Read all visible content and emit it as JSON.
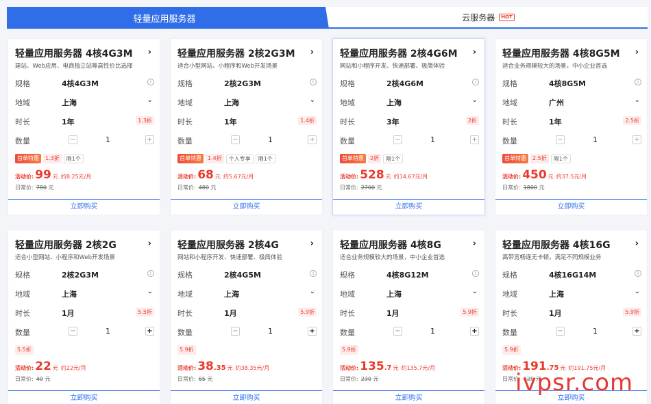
{
  "tabs": {
    "active_label": "轻量应用服务器",
    "cloud_label": "云服务器",
    "hot_badge": "HOT"
  },
  "labels": {
    "spec": "规格",
    "region": "地域",
    "duration": "时长",
    "quantity": "数量",
    "activity_price": "活动价:",
    "original_price": "日常价:",
    "buy": "立即购买",
    "first_order": "首单特惠",
    "currency": "元"
  },
  "cards": [
    {
      "title": "轻量应用服务器 4核4G3M",
      "desc": "建站、Web应用、电商独立站等高性价比选择",
      "spec": "4核4G3M",
      "region": "上海",
      "duration": "1年",
      "duration_disc": "1.3折",
      "qty": "1",
      "first_order": true,
      "disc": "1.3折",
      "extra_tags": [
        "限1个"
      ],
      "price_int": "99",
      "price_dec": "",
      "per_month": "约8.25元/月",
      "original": "780"
    },
    {
      "title": "轻量应用服务器 2核2G3M",
      "desc": "适合小型网站、小程序和Web开发场景",
      "spec": "2核2G3M",
      "region": "上海",
      "duration": "1年",
      "duration_disc": "1.4折",
      "qty": "1",
      "first_order": true,
      "disc": "1.4折",
      "extra_tags": [
        "个人专享",
        "限1个"
      ],
      "price_int": "68",
      "price_dec": "",
      "per_month": "约5.67元/月",
      "original": "480"
    },
    {
      "title": "轻量应用服务器 2核4G6M",
      "desc": "网站和小程序开发、快速部署、极简体验",
      "spec": "2核4G6M",
      "region": "上海",
      "duration": "3年",
      "duration_disc": "2折",
      "qty": "1",
      "first_order": true,
      "disc": "2折",
      "extra_tags": [
        "限1个"
      ],
      "price_int": "528",
      "price_dec": "",
      "per_month": "约14.67元/月",
      "original": "2700"
    },
    {
      "title": "轻量应用服务器 4核8G5M",
      "desc": "适合业务规模较大的场景，中小企业首选",
      "spec": "4核8G5M",
      "region": "广州",
      "duration": "1年",
      "duration_disc": "2.5折",
      "qty": "1",
      "first_order": true,
      "disc": "2.5折",
      "extra_tags": [
        "限1个"
      ],
      "price_int": "450",
      "price_dec": "",
      "per_month": "约37.5元/月",
      "original": "1800"
    },
    {
      "title": "轻量应用服务器 2核2G",
      "desc": "适合小型网站、小程序和Web开发场景",
      "spec": "2核2G3M",
      "region": "上海",
      "duration": "1月",
      "duration_disc": "5.5折",
      "qty": "1",
      "first_order": false,
      "disc": "5.5折",
      "extra_tags": [],
      "price_int": "22",
      "price_dec": "",
      "per_month": "约22元/月",
      "original": "40"
    },
    {
      "title": "轻量应用服务器 2核4G",
      "desc": "网站和小程序开发、快速部署、极简体验",
      "spec": "2核4G5M",
      "region": "上海",
      "duration": "1月",
      "duration_disc": "5.9折",
      "qty": "1",
      "first_order": false,
      "disc": "5.9折",
      "extra_tags": [],
      "price_int": "38",
      "price_dec": ".35",
      "per_month": "约38.35元/月",
      "original": "65"
    },
    {
      "title": "轻量应用服务器 4核8G",
      "desc": "适合业务规模较大的场景，中小企业首选",
      "spec": "4核8G12M",
      "region": "上海",
      "duration": "1月",
      "duration_disc": "5.9折",
      "qty": "1",
      "first_order": false,
      "disc": "5.9折",
      "extra_tags": [],
      "price_int": "135",
      "price_dec": ".7",
      "per_month": "约135.7元/月",
      "original": "230"
    },
    {
      "title": "轻量应用服务器 4核16G",
      "desc": "高带宽畅连无卡顿，满足不同规模业务",
      "spec": "4核16G14M",
      "region": "上海",
      "duration": "1月",
      "duration_disc": "5.9折",
      "qty": "1",
      "first_order": false,
      "disc": "5.9折",
      "extra_tags": [],
      "price_int": "191",
      "price_dec": ".75",
      "per_month": "约191.75元/月",
      "original": "325"
    }
  ],
  "watermark": "ivpsr.com"
}
